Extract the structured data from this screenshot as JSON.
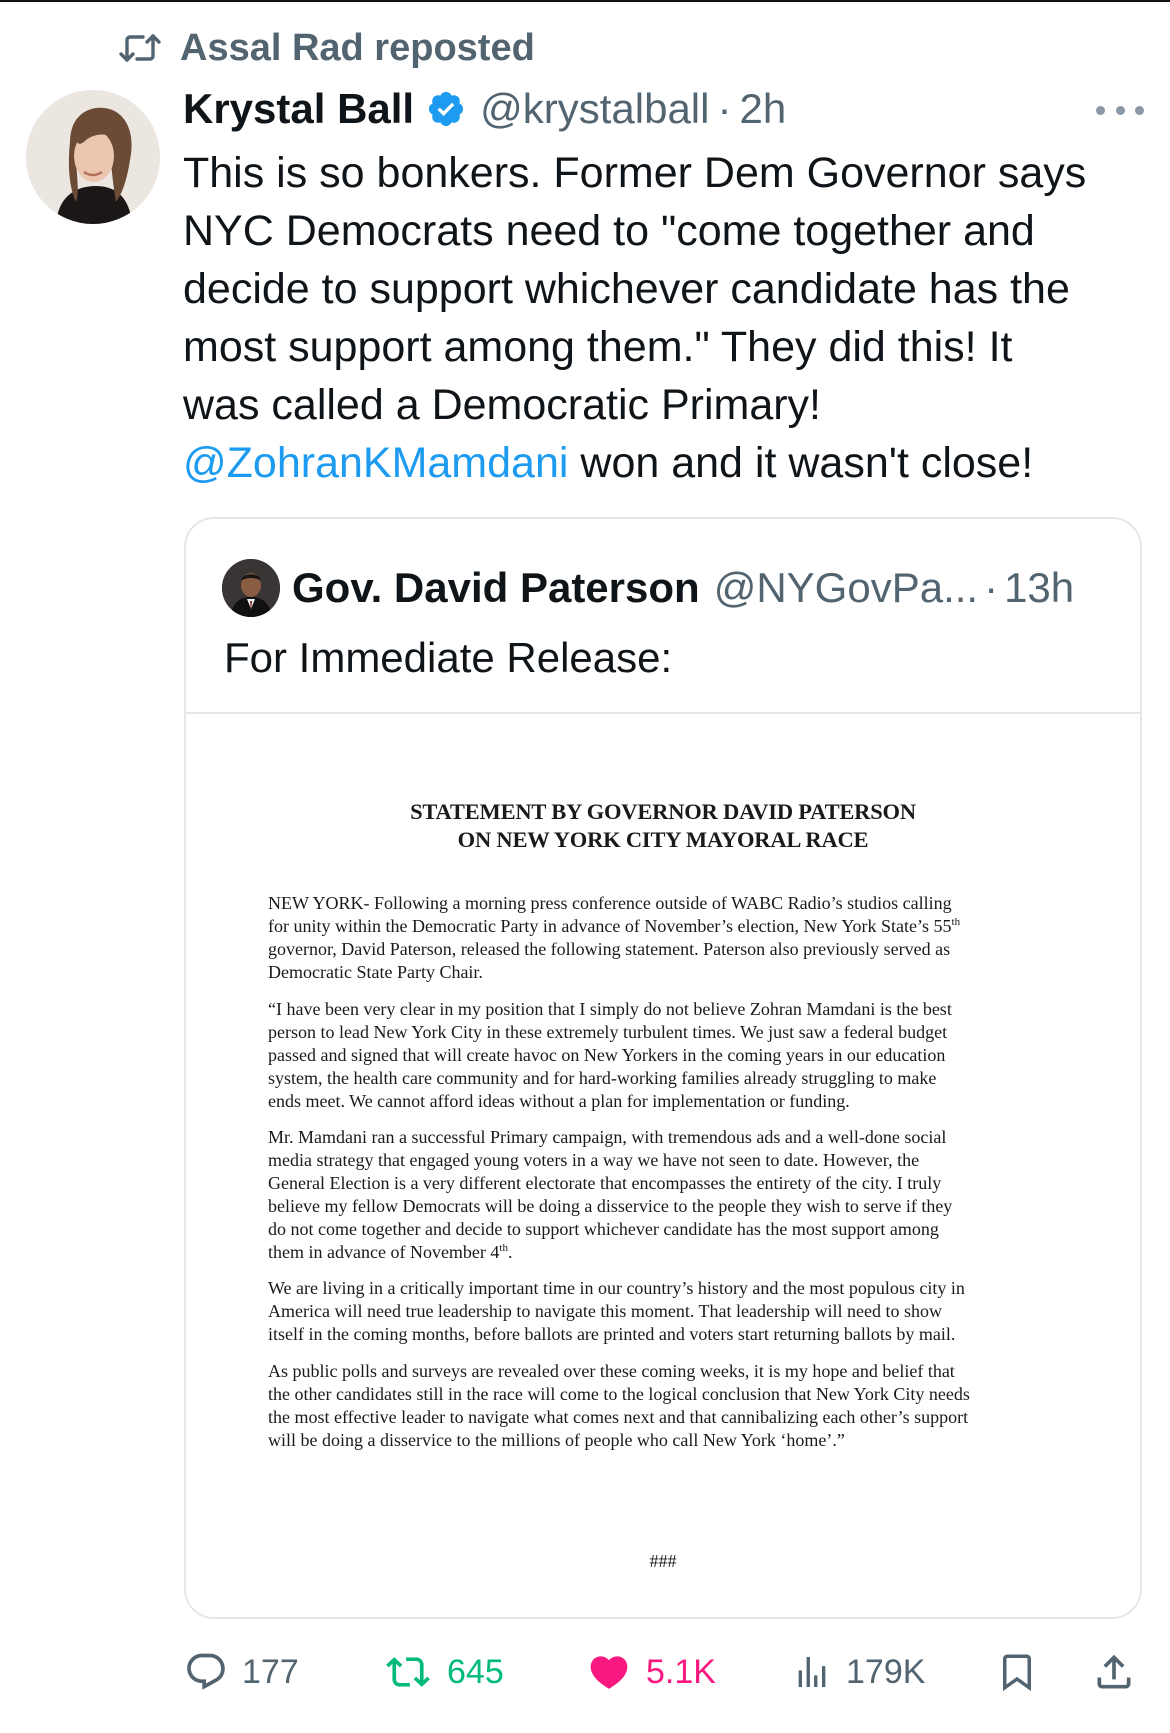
{
  "repost": {
    "icon": "repost-icon",
    "label": "Assal Rad reposted"
  },
  "tweet": {
    "author_name": "Krystal Ball",
    "verified_icon": "verified-badge-icon",
    "handle": "@krystalball",
    "separator": "·",
    "time": "2h",
    "more_icon": "more-options-icon",
    "lines": [
      "This is so bonkers. Former Dem Governor says",
      "NYC Democrats need to \"come together and",
      "decide to support whichever candidate has the",
      "most support among them.\" They did this! It",
      "was called a Democratic Primary!"
    ],
    "last_line_mention": "@ZohranKMamdani",
    "last_line_rest": " won and it wasn't close!",
    "colors": {
      "accent": "#1d9bf0",
      "muted": "#536471"
    }
  },
  "quote": {
    "author_name": "Gov. David Paterson",
    "handle": "@NYGovPa...",
    "separator": "·",
    "time": "13h",
    "text": "For Immediate Release:",
    "document": {
      "title_line1": "STATEMENT BY GOVERNOR DAVID PATERSON",
      "title_line2": "ON NEW YORK CITY MAYORAL RACE",
      "p1": [
        "NEW YORK- Following a morning press conference outside of WABC Radio’s studios calling",
        "for unity within the Democratic Party in advance of November’s election, New York State’s 55",
        "governor, David Paterson, released the following statement. Paterson also previously served as",
        "Democratic State Party Chair."
      ],
      "p1_sup": "th",
      "p2": [
        "“I have been very clear in my position that I simply do not believe Zohran Mamdani is the best",
        "person to lead New York City in these extremely turbulent times. We just saw a federal budget",
        "passed and signed that will create havoc on New Yorkers in the coming years in our education",
        "system, the health care community and for hard-working families already struggling to make",
        "ends meet. We cannot afford ideas without a plan for implementation or funding."
      ],
      "p3": [
        "Mr. Mamdani ran a successful Primary campaign, with tremendous ads and a well-done social",
        "media strategy that engaged young voters in a way we have not seen to date. However, the",
        "General Election is a very different electorate that encompasses the entirety of the city. I truly",
        "believe my fellow Democrats will be doing a disservice to the people they wish to serve if they",
        "do not come together and decide to support whichever candidate has the most support among",
        "them in advance of November 4"
      ],
      "p3_sup": "th",
      "p3_end": ".",
      "p4": [
        "We are living in a critically important time in our country’s history and the most populous city in",
        "America will need true leadership to navigate this moment. That leadership will need to show",
        "itself in the coming months, before ballots are printed and voters start returning ballots by mail."
      ],
      "p5": [
        "As public polls and surveys are revealed over these coming weeks, it is my hope and belief that",
        "the other candidates still in the race will come to the logical conclusion that New York City needs",
        "the most effective leader to navigate what comes next and that cannibalizing each other’s support",
        "will be doing a disservice to the millions of people who call New York ‘home’.”"
      ],
      "end_mark": "###"
    }
  },
  "actions": {
    "reply": {
      "icon": "reply-icon",
      "count": "177"
    },
    "repost": {
      "icon": "repost-icon",
      "count": "645",
      "color": "#00ba7c"
    },
    "like": {
      "icon": "heart-icon",
      "count": "5.1K",
      "color": "#f91880"
    },
    "views": {
      "icon": "views-icon",
      "count": "179K"
    },
    "bookmark": {
      "icon": "bookmark-icon"
    },
    "share": {
      "icon": "share-icon"
    }
  }
}
